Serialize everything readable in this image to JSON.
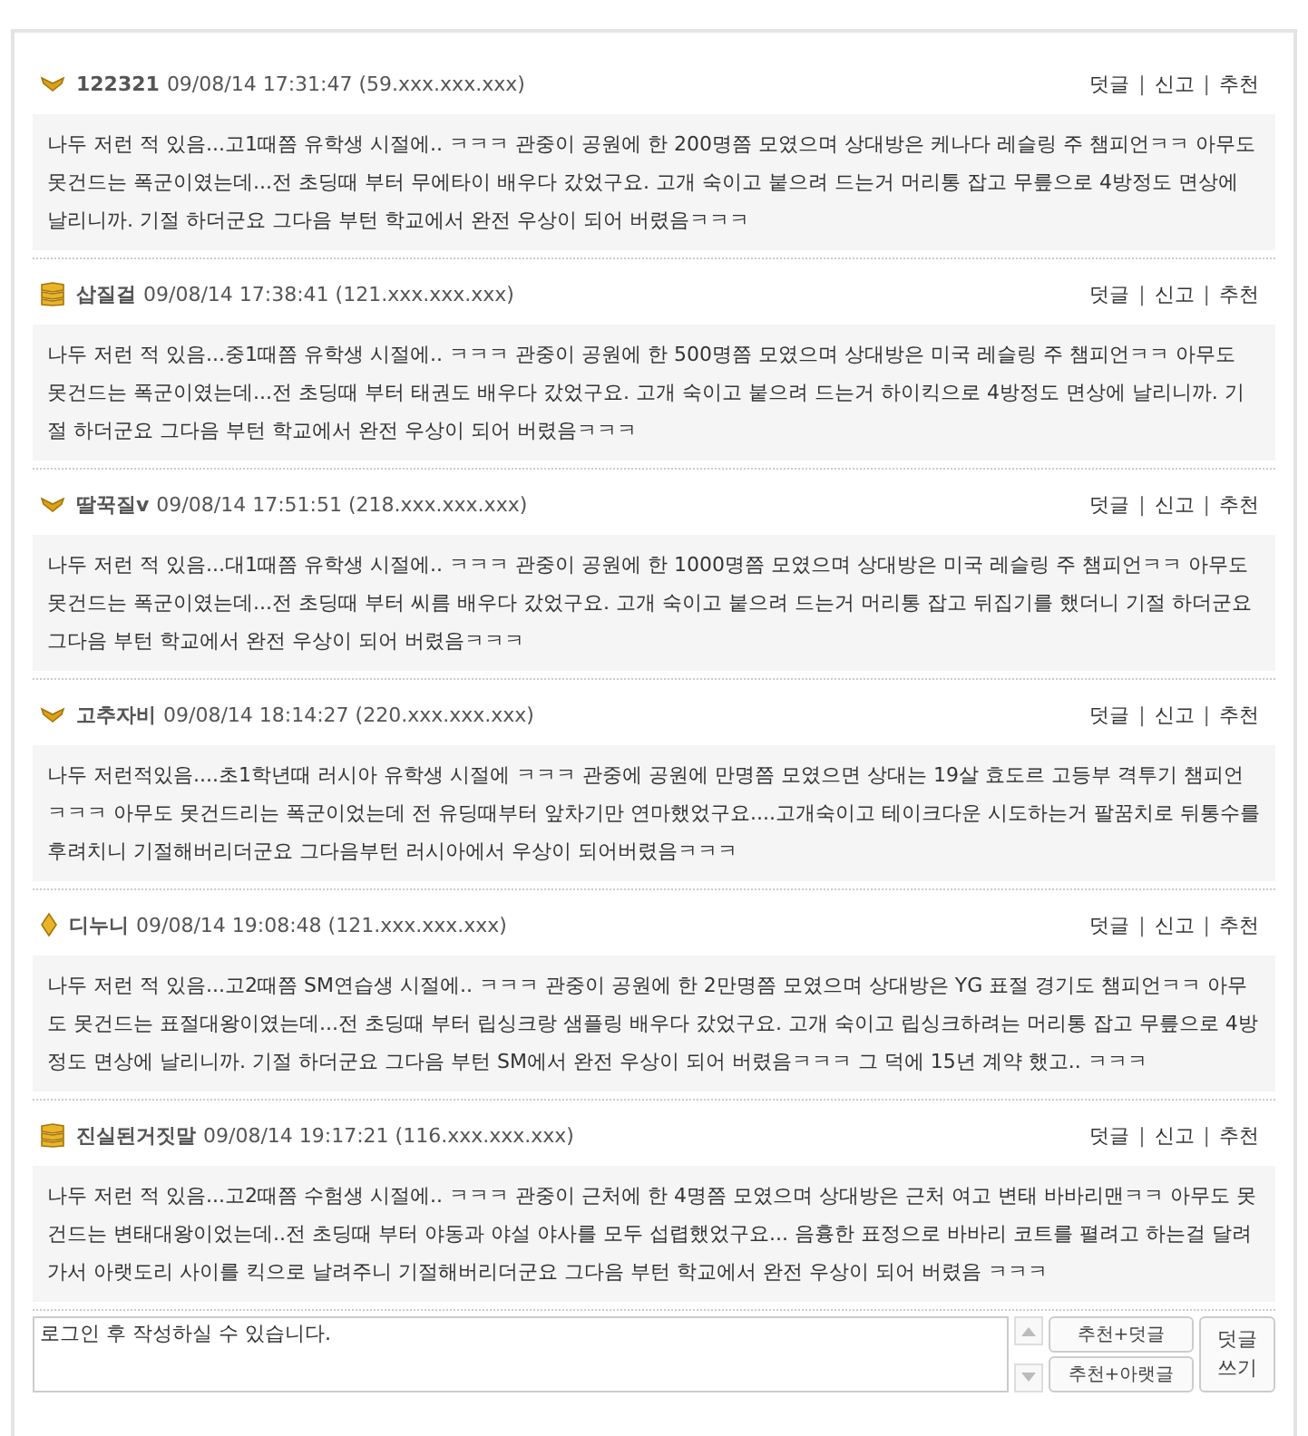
{
  "comments": [
    {
      "kind": "wing",
      "name": "122321",
      "meta": "09/08/14 17:31:47 (59.xxx.xxx.xxx)",
      "actions": [
        "덧글",
        "신고",
        "추천"
      ],
      "separators": [
        "|",
        "|"
      ],
      "body": "나두 저런 적 있음...고1때쯤 유학생 시절에.. ㅋㅋㅋ 관중이 공원에 한 200명쯤 모였으며 상대방은 케나다 레슬링 주 챔피언ㅋㅋ 아무도 못건드는 폭군이였는데...전 초딩때 부터 무에타이 배우다 갔었구요. 고개 숙이고 붙으려 드는거 머리통 잡고 무릎으로 4방정도 면상에 날리니까. 기절 하더군요 그다음 부턴 학교에서 완전 우상이 되어 버렸음ㅋㅋㅋ"
    },
    {
      "kind": "stack",
      "name": "삽질걸",
      "meta": "09/08/14 17:38:41 (121.xxx.xxx.xxx)",
      "actions": [
        "덧글",
        "신고",
        "추천"
      ],
      "separators": [
        "|",
        "|"
      ],
      "body": "나두 저런 적 있음...중1때쯤 유학생 시절에.. ㅋㅋㅋ 관중이 공원에 한 500명쯤 모였으며 상대방은 미국 레슬링 주 챔피언ㅋㅋ 아무도 못건드는 폭군이였는데...전 초딩때 부터 태권도 배우다 갔었구요. 고개 숙이고 붙으려 드는거 하이킥으로 4방정도 면상에 날리니까. 기절 하더군요 그다음 부턴 학교에서 완전 우상이 되어 버렸음ㅋㅋㅋ"
    },
    {
      "kind": "wing",
      "name": "딸꾹질v",
      "meta": "09/08/14 17:51:51 (218.xxx.xxx.xxx)",
      "actions": [
        "덧글",
        "신고",
        "추천"
      ],
      "separators": [
        "|",
        "|"
      ],
      "body": "나두 저런 적 있음...대1때쯤 유학생 시절에.. ㅋㅋㅋ 관중이 공원에 한 1000명쯤 모였으며 상대방은 미국 레슬링 주 챔피언ㅋㅋ 아무도 못건드는 폭군이였는데...전 초딩때 부터 씨름 배우다 갔었구요. 고개 숙이고 붙으려 드는거 머리통 잡고 뒤집기를 했더니 기절 하더군요 그다음 부턴 학교에서 완전 우상이 되어 버렸음ㅋㅋㅋ"
    },
    {
      "kind": "wing",
      "name": "고추자비",
      "meta": "09/08/14 18:14:27 (220.xxx.xxx.xxx)",
      "actions": [
        "덧글",
        "신고",
        "추천"
      ],
      "separators": [
        "|",
        "|"
      ],
      "body": "나두 저런적있음....초1학년때 러시아 유학생 시절에 ㅋㅋㅋ 관중에 공원에 만명쯤 모였으면 상대는 19살 효도르 고등부 격투기 챔피언 ㅋㅋㅋ 아무도 못건드리는 폭군이었는데 전 유딩때부터 앞차기만 연마했었구요....고개숙이고 테이크다운 시도하는거 팔꿈치로 뒤통수를 후려치니 기절해버리더군요 그다음부턴 러시아에서 우상이 되어버렸음ㅋㅋㅋ"
    },
    {
      "kind": "diamond",
      "name": "디누니",
      "meta": "09/08/14 19:08:48 (121.xxx.xxx.xxx)",
      "actions": [
        "덧글",
        "신고",
        "추천"
      ],
      "separators": [
        "|",
        "|"
      ],
      "body": "나두 저런 적 있음...고2때쯤 SM연습생 시절에.. ㅋㅋㅋ 관중이 공원에 한 2만명쯤 모였으며 상대방은 YG 표절 경기도 챔피언ㅋㅋ 아무도 못건드는 표절대왕이였는데...전 초딩때 부터 립싱크랑 샘플링 배우다 갔었구요. 고개 숙이고 립싱크하려는 머리통 잡고 무릎으로 4방정도 면상에 날리니까. 기절 하더군요 그다음 부턴 SM에서 완전 우상이 되어 버렸음ㅋㅋㅋ 그 덕에 15년 계약 했고.. ㅋㅋㅋ"
    },
    {
      "kind": "stack",
      "name": "진실된거짓말",
      "meta": "09/08/14 19:17:21 (116.xxx.xxx.xxx)",
      "actions": [
        "덧글",
        "신고",
        "추천"
      ],
      "separators": [
        "|",
        "|"
      ],
      "body": "나두 저런 적 있음...고2때쯤 수험생 시절에.. ㅋㅋㅋ 관중이 근처에 한 4명쯤 모였으며 상대방은 근처 여고 변태 바바리맨ㅋㅋ 아무도 못건드는 변태대왕이었는데..전 초딩때 부터 야동과 야설 야사를 모두 섭렵했었구요... 음흉한 표정으로 바바리 코트를 펼려고 하는걸 달려가서 아랫도리 사이를 킥으로 날려주니 기절해버리더군요 그다음 부턴 학교에서 완전 우상이 되어 버렸음 ㅋㅋㅋ"
    }
  ],
  "reply": {
    "value": "로그인 후 작성하실 수 있습니다.",
    "buttons": [
      "추천+덧글",
      "추천+아랫글"
    ],
    "submit": "덧글 쓰기"
  }
}
